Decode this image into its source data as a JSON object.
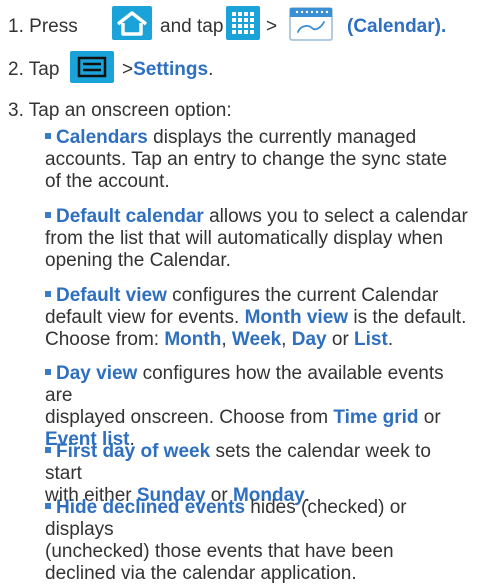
{
  "steps": [
    {
      "number": "1.",
      "text_a": "Press",
      "text_b": "and tap",
      "text_c": ">",
      "text_d": "(Calendar)."
    },
    {
      "number": "2.",
      "text_a": "Tap",
      "text_b": ">",
      "text_c": "Settings",
      "text_d": "."
    },
    {
      "number": "3.",
      "text_a": "Tap an onscreen option:"
    }
  ],
  "options": [
    {
      "label": "Calendars",
      "lines": [
        " displays the currently managed",
        "accounts. Tap an entry to change the sync state",
        "of the account."
      ]
    },
    {
      "label": "Default calendar",
      "lines": [
        " allows you to select a calendar",
        "from the list that will automatically display when",
        "opening the Calendar."
      ]
    },
    {
      "label": "Default view",
      "line1_rest": " configures the current Calendar",
      "line2_pre": "default view for events. ",
      "line2_em": "Month view",
      "line2_post": " is the default.",
      "line3_pre": "Choose from: ",
      "line3_em1": "Month",
      "line3_sep1": ", ",
      "line3_em2": "Week",
      "line3_sep2": ", ",
      "line3_em3": "Day",
      "line3_sep3": " or ",
      "line3_em4": "List",
      "line3_post": "."
    },
    {
      "label": "Day view",
      "line1_rest": " configures how the available events are",
      "line2_pre": "displayed onscreen. Choose from ",
      "line2_em": "Time grid",
      "line2_post": " or",
      "line3_em": "Event list",
      "line3_post": "."
    },
    {
      "label": "First day of week",
      "line1_rest": " sets the calendar week to start",
      "line2_pre": "with either ",
      "line2_em1": "Sunday",
      "line2_mid": " or ",
      "line2_em2": "Monday",
      "line2_post": "."
    },
    {
      "label": "Hide declined events",
      "lines": [
        " hides (checked) or displays",
        "(unchecked) those events that have been",
        "declined via the calendar application."
      ]
    }
  ],
  "icons": {
    "home": "home-icon",
    "apps": "apps-grid-icon",
    "calendar": "calendar-icon",
    "menu": "menu-icon"
  },
  "colors": {
    "text": "#333333",
    "accent": "#2e6fbf",
    "icon_bg": "#1aa3d8"
  }
}
